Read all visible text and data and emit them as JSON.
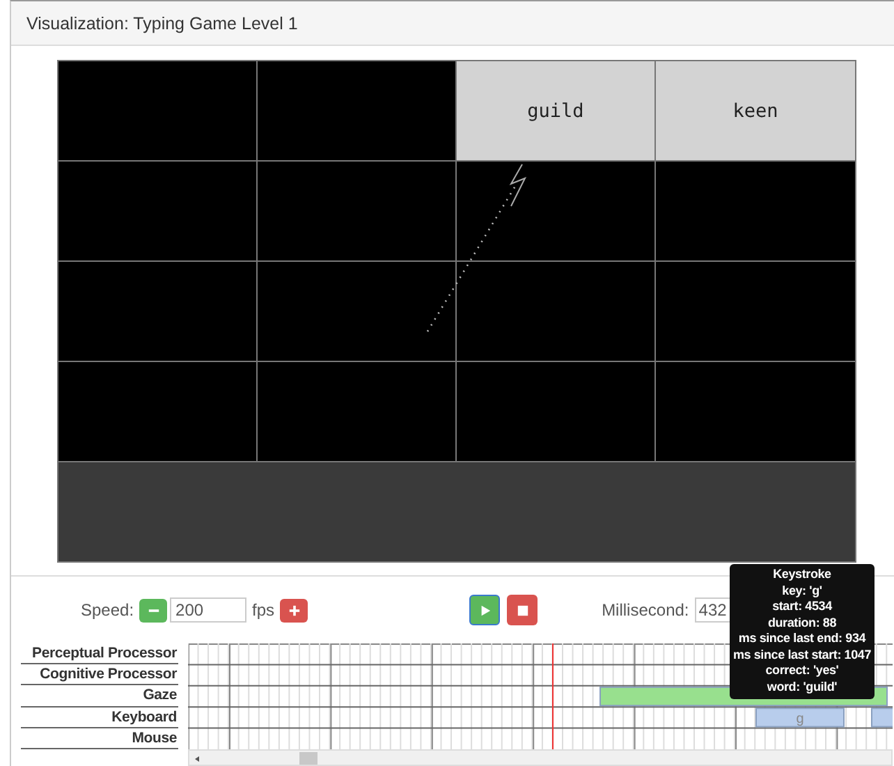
{
  "panel": {
    "title": "Visualization: Typing Game Level 1"
  },
  "board": {
    "rows": [
      [
        {
          "kind": "empty"
        },
        {
          "kind": "empty"
        },
        {
          "kind": "word",
          "text": "guild"
        },
        {
          "kind": "word",
          "text": "keen"
        }
      ],
      [
        {
          "kind": "empty"
        },
        {
          "kind": "empty"
        },
        {
          "kind": "empty"
        },
        {
          "kind": "empty"
        }
      ],
      [
        {
          "kind": "empty"
        },
        {
          "kind": "empty"
        },
        {
          "kind": "empty"
        },
        {
          "kind": "empty"
        }
      ],
      [
        {
          "kind": "empty"
        },
        {
          "kind": "empty"
        },
        {
          "kind": "empty"
        },
        {
          "kind": "empty"
        }
      ]
    ]
  },
  "controls": {
    "speed_label": "Speed:",
    "speed_value": "200",
    "speed_unit": "fps",
    "millisecond_label": "Millisecond:",
    "millisecond_value": "432"
  },
  "timeline": {
    "tracks": [
      {
        "label": "Perceptual Processor"
      },
      {
        "label": "Cognitive Processor"
      },
      {
        "label": "Gaze",
        "bars": [
          {
            "color": "#98e08e"
          }
        ]
      },
      {
        "label": "Keyboard",
        "bars": [
          {
            "color": "#b8cdec",
            "text": "g"
          },
          {
            "color": "#b8cdec"
          }
        ]
      },
      {
        "label": "Mouse"
      }
    ]
  },
  "tooltip": {
    "lines": [
      "Keystroke",
      "key: 'g'",
      "start: 4534",
      "duration: 88",
      "ms since last end: 934",
      "ms since last start: 1047",
      "correct: 'yes'",
      "word: 'guild'"
    ]
  }
}
